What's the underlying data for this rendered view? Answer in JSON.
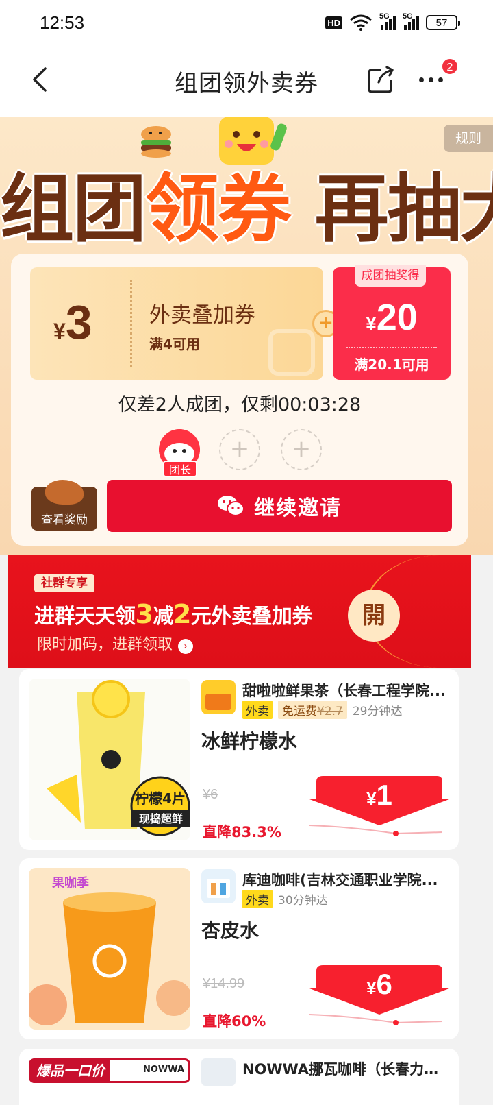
{
  "status_bar": {
    "time": "12:53",
    "hd": "HD",
    "sig1": "5G",
    "sig2": "5G",
    "battery": "57"
  },
  "nav": {
    "title": "组团领外卖券",
    "badge": "2"
  },
  "hero": {
    "rules": "规则",
    "title_part1": "组团",
    "title_part2": "领券",
    "title_part3": " 再抽大奖"
  },
  "coupon": {
    "currency": "¥",
    "amount": "3",
    "name": "外卖叠加券",
    "condition": "满4可用",
    "plus": "+",
    "prize_tag": "成团抽奖得",
    "prize_currency": "¥",
    "prize_amount": "20",
    "prize_condition": "满20.1可用"
  },
  "team": {
    "status": "仅差2人成团，仅剩00:03:28",
    "leader_tag": "团长",
    "slot_symbol": "+",
    "reward_label": "查看奖励",
    "invite_label": "继续邀请"
  },
  "group_banner": {
    "tag": "社群专享",
    "headline_a": "进群天天领",
    "headline_num1": "3",
    "headline_b": "减",
    "headline_num2": "2",
    "headline_c": "元外卖叠加券",
    "sub": "限时加码，进群领取",
    "arrow": "›",
    "open": "開"
  },
  "products": [
    {
      "store": "甜啦啦鲜果茶（长春工程学院...",
      "tag_wm": "外卖",
      "tag_free": "免运费",
      "free_orig": "¥2.7",
      "eta": "29分钟达",
      "name": "冰鲜柠檬水",
      "orig_price": "¥6",
      "discount": "直降83.3%",
      "currency": "¥",
      "price": "1",
      "img_label_1": "柠檬4片",
      "img_label_2": "现捣超鲜"
    },
    {
      "store": "库迪咖啡(吉林交通职业学院...",
      "tag_wm": "外卖",
      "eta": "30分钟达",
      "name": "杏皮水",
      "orig_price": "¥14.99",
      "discount": "直降60%",
      "currency": "¥",
      "price": "6",
      "img_label_1": "果咖季"
    }
  ],
  "third_product": {
    "badge": "爆品一口价",
    "brand": "NOWWA",
    "store": "NOWWA挪瓦咖啡（长春力旺..."
  },
  "colors": {
    "brand_red": "#e8102f",
    "coupon_brown": "#6b2f12",
    "highlight_orange": "#ff5a12",
    "banner_red": "#e8131c"
  },
  "icons": [
    "back-icon",
    "share-icon",
    "more-icon",
    "wechat-icon",
    "wifi-icon",
    "signal-icon",
    "battery-icon"
  ]
}
